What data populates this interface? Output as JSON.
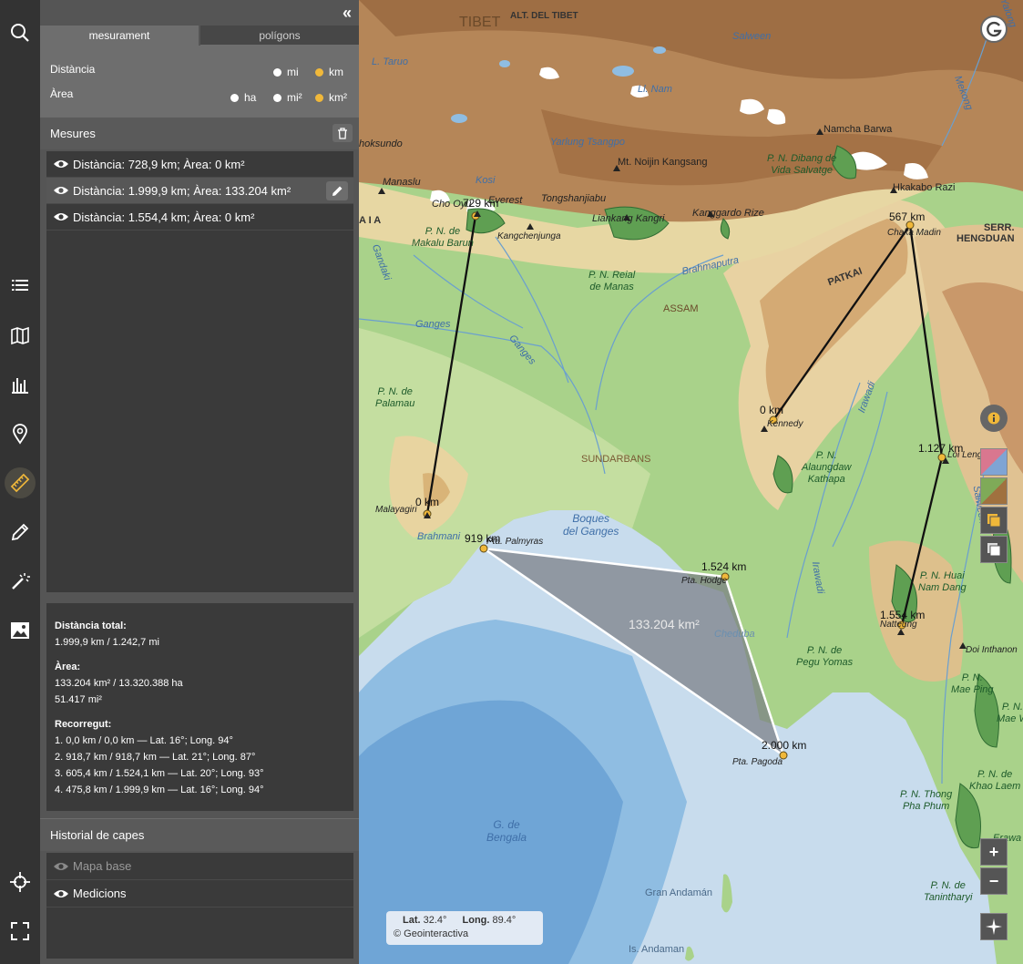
{
  "panel": {
    "collapse_icon": "double-chevron-left-icon",
    "tabs": [
      "mesurament",
      "polígons"
    ],
    "units": {
      "distance_label": "Distància",
      "area_label": "Àrea",
      "distance_options": [
        {
          "label": "mi",
          "selected": false
        },
        {
          "label": "km",
          "selected": true
        }
      ],
      "area_options": [
        {
          "label": "ha",
          "selected": false
        },
        {
          "label": "mi²",
          "selected": false
        },
        {
          "label": "km²",
          "selected": true
        }
      ]
    },
    "measures_title": "Mesures",
    "measures": [
      {
        "text": "Distància: 728,9 km; Àrea: 0 km²",
        "selected": false
      },
      {
        "text": "Distància: 1.999,9 km; Àrea: 133.204 km²",
        "selected": true
      },
      {
        "text": "Distància: 1.554,4 km; Àrea: 0 km²",
        "selected": false
      }
    ],
    "info": {
      "total_title": "Distància total:",
      "total_value": "1.999,9 km / 1.242,7 mi",
      "area_title": "Àrea:",
      "area_value_1": "133.204 km² / 13.320.388 ha",
      "area_value_2": "51.417 mi²",
      "route_title": "Recorregut:",
      "route": [
        "1. 0,0 km / 0,0 km — Lat. 16°; Long. 94°",
        "2. 918,7 km / 918,7 km — Lat. 21°; Long. 87°",
        "3. 605,4 km / 1.524,1 km — Lat. 20°; Long. 93°",
        "4. 475,8 km / 1.999,9 km — Lat. 16°; Long. 94°"
      ]
    },
    "history_title": "Historial de capes",
    "history": [
      {
        "label": "Mapa base",
        "dim": true
      },
      {
        "label": "Medicions",
        "dim": false
      }
    ]
  },
  "rail_icons": [
    "search-icon",
    "list-icon",
    "map-book-icon",
    "chart-bars-icon",
    "location-pin-icon",
    "ruler-icon",
    "pencil-icon",
    "magic-wand-icon",
    "image-icon",
    "crosshair-icon",
    "fullscreen-icon"
  ],
  "map": {
    "labels": {
      "tibet": "TIBET",
      "alt_tibet": "ALT. DEL TIBET",
      "salween_n": "Salween",
      "yalong": "Yalong",
      "l_taruo": "L. Taruo",
      "l_nam": "Ll. Nam",
      "mekong": "Mekong",
      "namcha_barwa": "Namcha Barwa",
      "yarlung": "Yarlung Tsangpo",
      "noijin": "Mt. Noijin Kangsang",
      "pn_dibang": "P. N. Dibang de\nVida Salvatge",
      "hkakabo": "Hkakabo Razi",
      "oksundo": "hoksundo",
      "manaslu": "Manaslu",
      "kosi": "Kosi",
      "cho_oyu": "Cho Oyu",
      "everest": "Everest",
      "tongshan": "Tongshanjiabu",
      "liankang": "Liankang Kangri",
      "kanggardo": "Kanggardo Rize",
      "chaka_madin": "Chaka Madin",
      "serr_hengduan": "SERR.\nHENGDUAN",
      "aia": "A I A",
      "pn_makalu": "P. N. de\nMakalu Barun",
      "kangchenjunga": "Kangchenjunga",
      "gandaki": "Gandaki",
      "pn_manas": "P. N. Reial\nde Manas",
      "brahmaputra": "Brahmaputra",
      "patkai": "PATKAI",
      "assam": "ASSAM",
      "ganges1": "Ganges",
      "ganges2": "Ganges",
      "pn_palamau": "P. N. de\nPalamau",
      "irawadi1": "Irawadi",
      "kennedy": "Kennedy",
      "sundarbans": "SUNDARBANS",
      "pn_alaungdaw": "P. N.\nAlaungdaw\nKathapa",
      "loi_leng": "Loi Leng",
      "salween_s": "Salween",
      "malayagiri": "Malayagiri",
      "boques_ganges": "Boques\ndel Ganges",
      "brahmani": "Brahmani",
      "pta_palmyras": "Pta. Palmyras",
      "pta_hodge": "Pta. Hodge",
      "irawadi2": "Irawadi",
      "pn_huai": "P. N. Huai\nNam Dang",
      "natteung": "Natteung",
      "cheduba": "Cheduba",
      "pn_pegu": "P. N. de\nPegu Yomas",
      "doi_inthanon": "Doi Inthanon",
      "pn_mae_ping": "P. N.\nMae Ping",
      "mae_w": "P. N.\nMae W",
      "pta_pagoda": "Pta. Pagoda",
      "pn_khao": "P. N. de\nKhao Laem",
      "pn_thong": "P. N. Thong\nPha Phum",
      "g_bengala": "G. de\nBengala",
      "erawa": "Erawa",
      "gran_andaman": "Gran Andamán",
      "pn_tanin": "P. N. de\nTanintharyi",
      "is_andaman": "Is. Andaman"
    },
    "measure_labels": {
      "m1_a": "729 km",
      "m1_b": "0 km",
      "m3_a": "567 km",
      "m3_b": "0 km",
      "m3_c": "1.127 km",
      "m3_d": "1.554 km",
      "m2_a": "919 km",
      "m2_b": "1.524 km",
      "m2_c": "2.000 km",
      "area": "133.204 km²"
    },
    "coords": {
      "lat_label": "Lat.",
      "lat": "32.4°",
      "long_label": "Long.",
      "long": "89.4°",
      "credit": "© Geointeractiva"
    },
    "controls": {
      "info_icon": "info-icon",
      "zoom_in": "+",
      "zoom_out": "−"
    },
    "colors": {
      "sea": "#c6dcec",
      "deep_sea": "#7fb1d9",
      "lowland": "#a9d28a",
      "plateau": "#a8784a",
      "accent": "#f0b83a"
    }
  }
}
